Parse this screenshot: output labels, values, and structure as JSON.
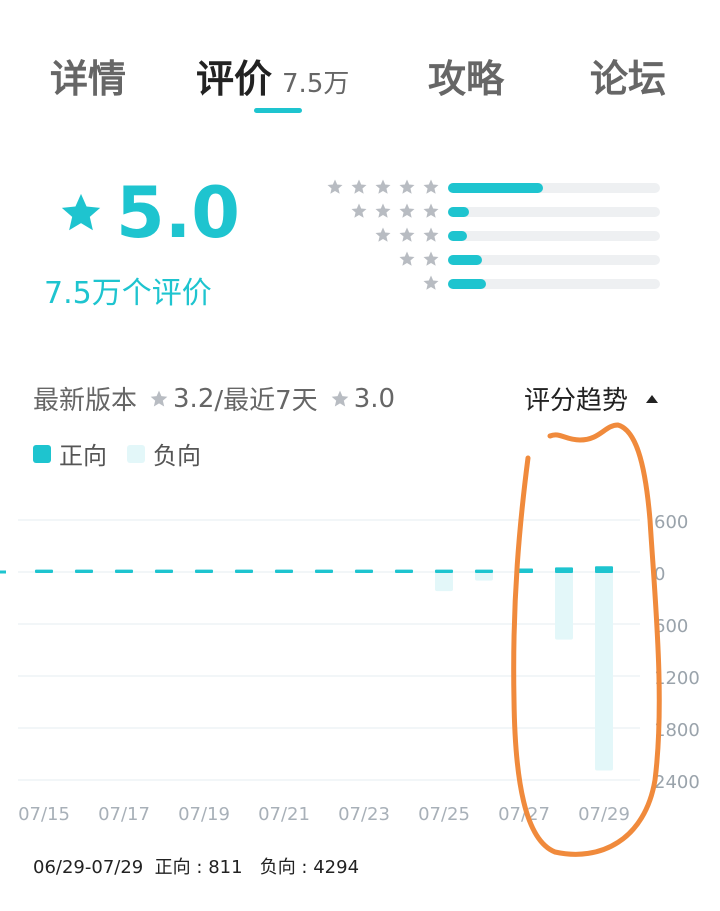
{
  "tabs": [
    {
      "label": "详情",
      "active": false
    },
    {
      "label": "评价",
      "active": true,
      "count": "7.5万"
    },
    {
      "label": "攻略",
      "active": false
    },
    {
      "label": "论坛",
      "active": false
    }
  ],
  "rating": {
    "score": "5.0",
    "count_label": "7.5万个评价",
    "distribution": [
      {
        "stars": 5,
        "fraction": 0.45
      },
      {
        "stars": 4,
        "fraction": 0.1
      },
      {
        "stars": 3,
        "fraction": 0.09
      },
      {
        "stars": 2,
        "fraction": 0.16
      },
      {
        "stars": 1,
        "fraction": 0.18
      }
    ]
  },
  "version_row": {
    "latest_label": "最新版本",
    "latest_score": "3.2",
    "recent_label": "/最近7天",
    "recent_score": "3.0",
    "trend_label": "评分趋势"
  },
  "legend": {
    "positive": "正向",
    "negative": "负向"
  },
  "colors": {
    "accent": "#1ec4cf",
    "negative": "#e3f7f9",
    "annotation": "#f08a3c"
  },
  "chart_data": {
    "type": "bar",
    "x": [
      "07/15",
      "07/16",
      "07/17",
      "07/18",
      "07/19",
      "07/20",
      "07/21",
      "07/22",
      "07/23",
      "07/24",
      "07/25",
      "07/26",
      "07/27",
      "07/28",
      "07/29"
    ],
    "x_ticks": [
      "07/15",
      "07/17",
      "07/19",
      "07/21",
      "07/23",
      "07/25",
      "07/27",
      "07/29"
    ],
    "y_ticks": [
      "600",
      "0",
      "600",
      "1200",
      "1800",
      "2400"
    ],
    "series": [
      {
        "name": "正向",
        "values": [
          30,
          30,
          30,
          30,
          30,
          30,
          30,
          30,
          30,
          30,
          30,
          30,
          40,
          50,
          60
        ]
      },
      {
        "name": "负向",
        "values": [
          0,
          0,
          0,
          0,
          0,
          0,
          0,
          0,
          0,
          0,
          220,
          100,
          0,
          780,
          2290
        ]
      }
    ],
    "ylim": [
      -600,
      2400
    ],
    "grid": true
  },
  "footer": {
    "summary": "06/29-07/29  正向 : 811   负向 : 4294"
  }
}
